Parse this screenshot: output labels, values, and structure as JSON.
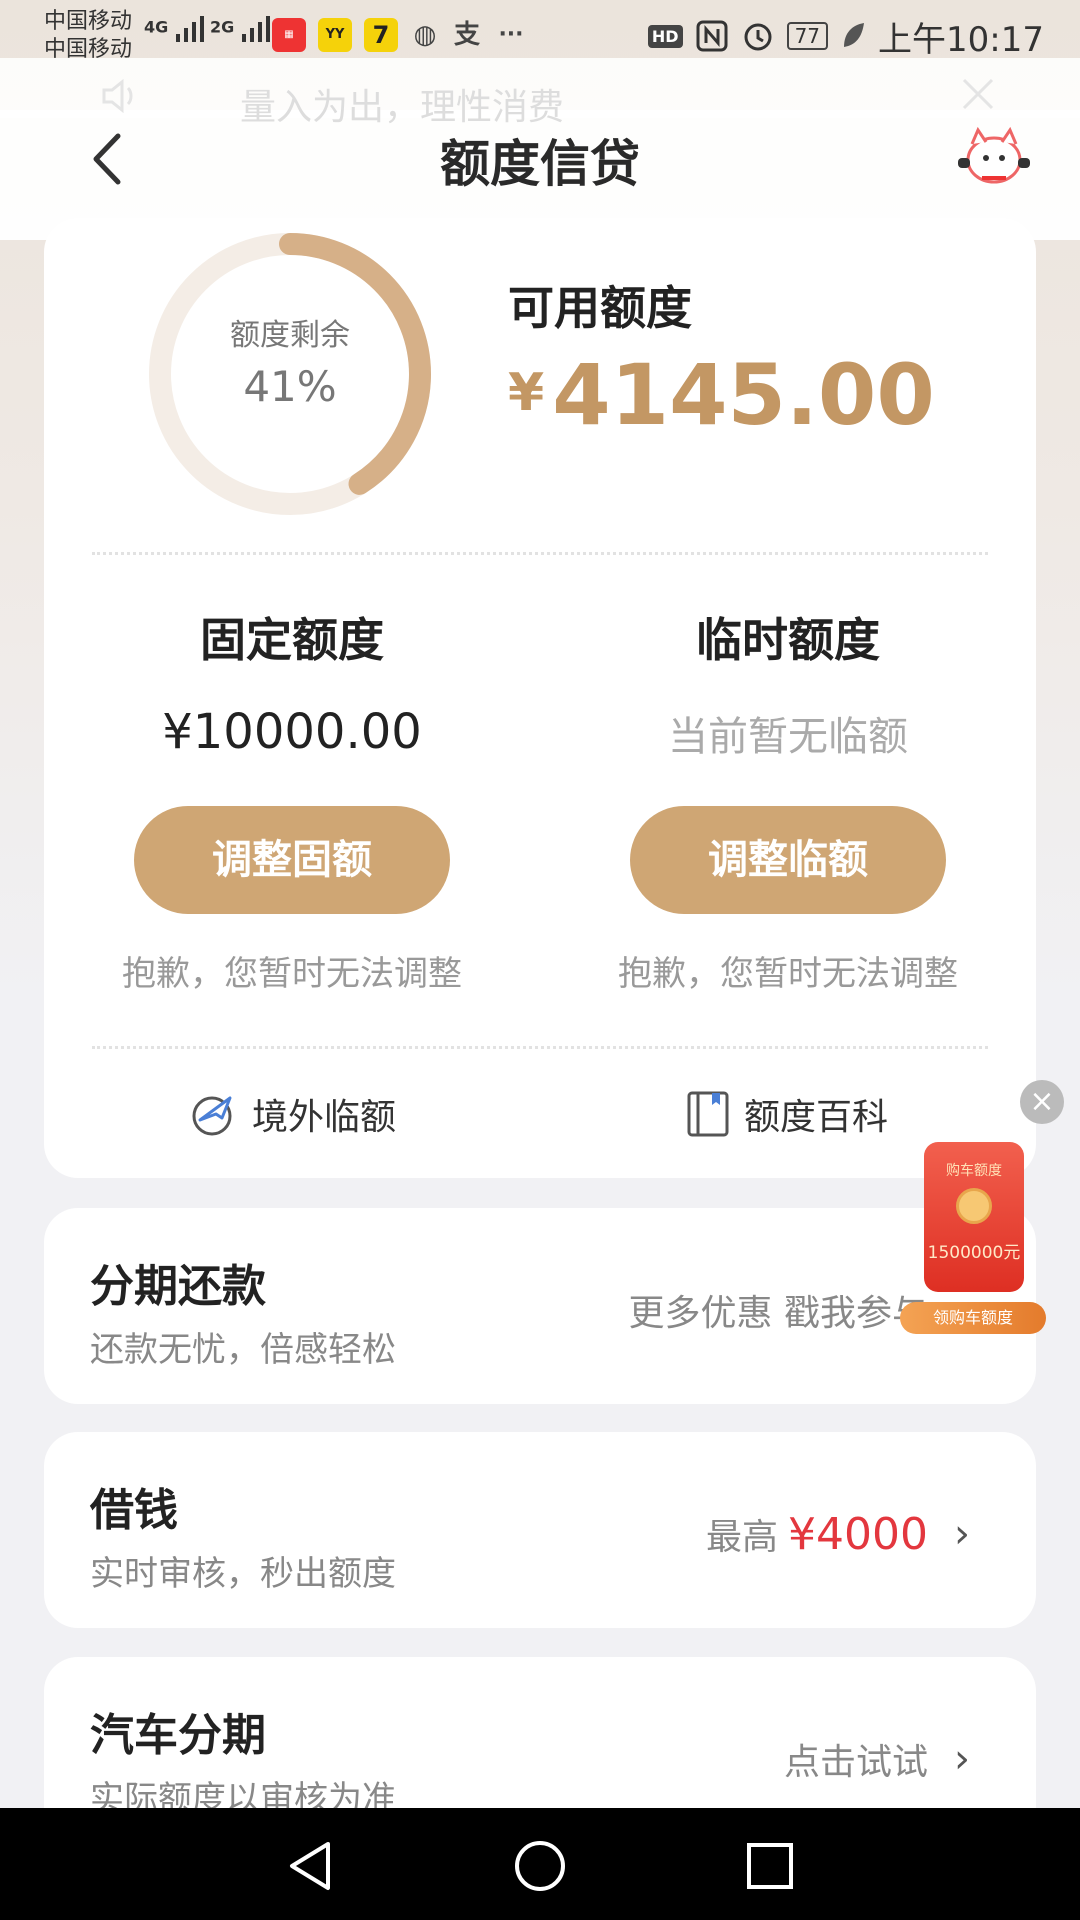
{
  "status_bar": {
    "carrier_1": "中国移动",
    "carrier_2": "中国移动",
    "net_1": "4G",
    "net_2": "2G",
    "battery": "77",
    "time": "上午10:17",
    "hd": "HD",
    "app_icon_yy": "YY",
    "app_icon_7": "7",
    "more": "···"
  },
  "notice": {
    "text": "量入为出，理性消费"
  },
  "header": {
    "title": "额度信贷"
  },
  "summary": {
    "donut_label": "额度剩余",
    "donut_percent": "41%",
    "remaining_fraction": 0.41,
    "available_title": "可用额度",
    "currency": "¥",
    "available_amount": "4145.00",
    "accent_color": "#c39764"
  },
  "fixed": {
    "title": "固定额度",
    "value": "¥10000.00",
    "button": "调整固额",
    "note": "抱歉，您暂时无法调整"
  },
  "temporary": {
    "title": "临时额度",
    "value": "当前暂无临额",
    "button": "调整临额",
    "note": "抱歉，您暂时无法调整"
  },
  "links": {
    "overseas": "境外临额",
    "encyclopedia": "额度百科"
  },
  "installment": {
    "title": "分期还款",
    "subtitle": "还款无忧，倍感轻松",
    "right": "更多优惠 戳我参与"
  },
  "borrow": {
    "title": "借钱",
    "subtitle": "实时审核，秒出额度",
    "prefix": "最高",
    "amount": "¥4000"
  },
  "car": {
    "title": "汽车分期",
    "subtitle": "实际额度以审核为准",
    "right": "点击试试"
  },
  "promo": {
    "envelope_title": "购车额度",
    "amount": "1500000元",
    "tag": "领购车额度"
  }
}
